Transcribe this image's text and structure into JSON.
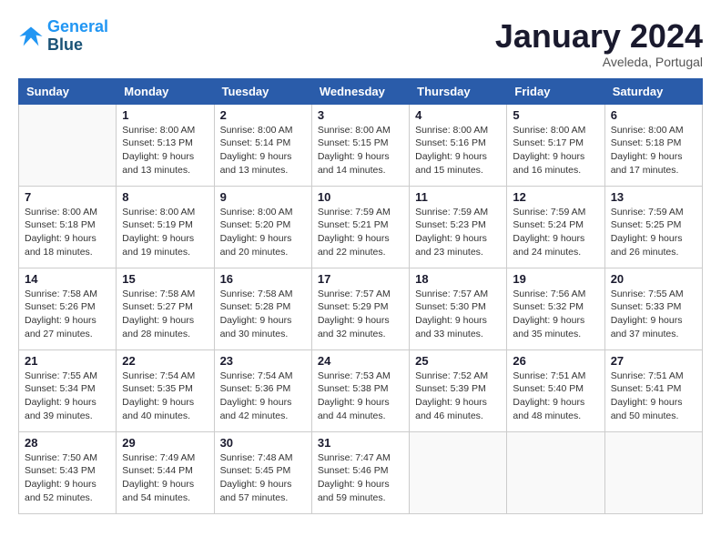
{
  "header": {
    "logo_line1": "General",
    "logo_line2": "Blue",
    "month_title": "January 2024",
    "location": "Aveleda, Portugal"
  },
  "weekdays": [
    "Sunday",
    "Monday",
    "Tuesday",
    "Wednesday",
    "Thursday",
    "Friday",
    "Saturday"
  ],
  "weeks": [
    [
      {
        "day": "",
        "sunrise": "",
        "sunset": "",
        "daylight": ""
      },
      {
        "day": "1",
        "sunrise": "Sunrise: 8:00 AM",
        "sunset": "Sunset: 5:13 PM",
        "daylight": "Daylight: 9 hours and 13 minutes."
      },
      {
        "day": "2",
        "sunrise": "Sunrise: 8:00 AM",
        "sunset": "Sunset: 5:14 PM",
        "daylight": "Daylight: 9 hours and 13 minutes."
      },
      {
        "day": "3",
        "sunrise": "Sunrise: 8:00 AM",
        "sunset": "Sunset: 5:15 PM",
        "daylight": "Daylight: 9 hours and 14 minutes."
      },
      {
        "day": "4",
        "sunrise": "Sunrise: 8:00 AM",
        "sunset": "Sunset: 5:16 PM",
        "daylight": "Daylight: 9 hours and 15 minutes."
      },
      {
        "day": "5",
        "sunrise": "Sunrise: 8:00 AM",
        "sunset": "Sunset: 5:17 PM",
        "daylight": "Daylight: 9 hours and 16 minutes."
      },
      {
        "day": "6",
        "sunrise": "Sunrise: 8:00 AM",
        "sunset": "Sunset: 5:18 PM",
        "daylight": "Daylight: 9 hours and 17 minutes."
      }
    ],
    [
      {
        "day": "7",
        "sunrise": "Sunrise: 8:00 AM",
        "sunset": "Sunset: 5:18 PM",
        "daylight": "Daylight: 9 hours and 18 minutes."
      },
      {
        "day": "8",
        "sunrise": "Sunrise: 8:00 AM",
        "sunset": "Sunset: 5:19 PM",
        "daylight": "Daylight: 9 hours and 19 minutes."
      },
      {
        "day": "9",
        "sunrise": "Sunrise: 8:00 AM",
        "sunset": "Sunset: 5:20 PM",
        "daylight": "Daylight: 9 hours and 20 minutes."
      },
      {
        "day": "10",
        "sunrise": "Sunrise: 7:59 AM",
        "sunset": "Sunset: 5:21 PM",
        "daylight": "Daylight: 9 hours and 22 minutes."
      },
      {
        "day": "11",
        "sunrise": "Sunrise: 7:59 AM",
        "sunset": "Sunset: 5:23 PM",
        "daylight": "Daylight: 9 hours and 23 minutes."
      },
      {
        "day": "12",
        "sunrise": "Sunrise: 7:59 AM",
        "sunset": "Sunset: 5:24 PM",
        "daylight": "Daylight: 9 hours and 24 minutes."
      },
      {
        "day": "13",
        "sunrise": "Sunrise: 7:59 AM",
        "sunset": "Sunset: 5:25 PM",
        "daylight": "Daylight: 9 hours and 26 minutes."
      }
    ],
    [
      {
        "day": "14",
        "sunrise": "Sunrise: 7:58 AM",
        "sunset": "Sunset: 5:26 PM",
        "daylight": "Daylight: 9 hours and 27 minutes."
      },
      {
        "day": "15",
        "sunrise": "Sunrise: 7:58 AM",
        "sunset": "Sunset: 5:27 PM",
        "daylight": "Daylight: 9 hours and 28 minutes."
      },
      {
        "day": "16",
        "sunrise": "Sunrise: 7:58 AM",
        "sunset": "Sunset: 5:28 PM",
        "daylight": "Daylight: 9 hours and 30 minutes."
      },
      {
        "day": "17",
        "sunrise": "Sunrise: 7:57 AM",
        "sunset": "Sunset: 5:29 PM",
        "daylight": "Daylight: 9 hours and 32 minutes."
      },
      {
        "day": "18",
        "sunrise": "Sunrise: 7:57 AM",
        "sunset": "Sunset: 5:30 PM",
        "daylight": "Daylight: 9 hours and 33 minutes."
      },
      {
        "day": "19",
        "sunrise": "Sunrise: 7:56 AM",
        "sunset": "Sunset: 5:32 PM",
        "daylight": "Daylight: 9 hours and 35 minutes."
      },
      {
        "day": "20",
        "sunrise": "Sunrise: 7:55 AM",
        "sunset": "Sunset: 5:33 PM",
        "daylight": "Daylight: 9 hours and 37 minutes."
      }
    ],
    [
      {
        "day": "21",
        "sunrise": "Sunrise: 7:55 AM",
        "sunset": "Sunset: 5:34 PM",
        "daylight": "Daylight: 9 hours and 39 minutes."
      },
      {
        "day": "22",
        "sunrise": "Sunrise: 7:54 AM",
        "sunset": "Sunset: 5:35 PM",
        "daylight": "Daylight: 9 hours and 40 minutes."
      },
      {
        "day": "23",
        "sunrise": "Sunrise: 7:54 AM",
        "sunset": "Sunset: 5:36 PM",
        "daylight": "Daylight: 9 hours and 42 minutes."
      },
      {
        "day": "24",
        "sunrise": "Sunrise: 7:53 AM",
        "sunset": "Sunset: 5:38 PM",
        "daylight": "Daylight: 9 hours and 44 minutes."
      },
      {
        "day": "25",
        "sunrise": "Sunrise: 7:52 AM",
        "sunset": "Sunset: 5:39 PM",
        "daylight": "Daylight: 9 hours and 46 minutes."
      },
      {
        "day": "26",
        "sunrise": "Sunrise: 7:51 AM",
        "sunset": "Sunset: 5:40 PM",
        "daylight": "Daylight: 9 hours and 48 minutes."
      },
      {
        "day": "27",
        "sunrise": "Sunrise: 7:51 AM",
        "sunset": "Sunset: 5:41 PM",
        "daylight": "Daylight: 9 hours and 50 minutes."
      }
    ],
    [
      {
        "day": "28",
        "sunrise": "Sunrise: 7:50 AM",
        "sunset": "Sunset: 5:43 PM",
        "daylight": "Daylight: 9 hours and 52 minutes."
      },
      {
        "day": "29",
        "sunrise": "Sunrise: 7:49 AM",
        "sunset": "Sunset: 5:44 PM",
        "daylight": "Daylight: 9 hours and 54 minutes."
      },
      {
        "day": "30",
        "sunrise": "Sunrise: 7:48 AM",
        "sunset": "Sunset: 5:45 PM",
        "daylight": "Daylight: 9 hours and 57 minutes."
      },
      {
        "day": "31",
        "sunrise": "Sunrise: 7:47 AM",
        "sunset": "Sunset: 5:46 PM",
        "daylight": "Daylight: 9 hours and 59 minutes."
      },
      {
        "day": "",
        "sunrise": "",
        "sunset": "",
        "daylight": ""
      },
      {
        "day": "",
        "sunrise": "",
        "sunset": "",
        "daylight": ""
      },
      {
        "day": "",
        "sunrise": "",
        "sunset": "",
        "daylight": ""
      }
    ]
  ]
}
